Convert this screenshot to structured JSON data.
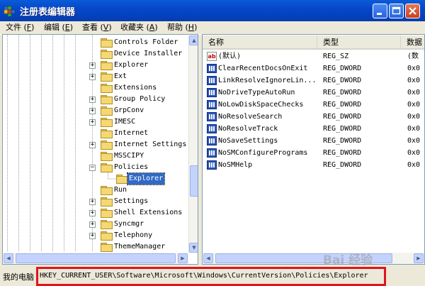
{
  "window": {
    "title": "注册表编辑器",
    "icon": "regedit-icon",
    "controls": [
      "minimize",
      "maximize",
      "close"
    ]
  },
  "menu": [
    {
      "label": "文件",
      "key": "F"
    },
    {
      "label": "编辑",
      "key": "E"
    },
    {
      "label": "查看",
      "key": "V"
    },
    {
      "label": "收藏夹",
      "key": "A"
    },
    {
      "label": "帮助",
      "key": "H"
    }
  ],
  "tree": {
    "items": [
      {
        "label": "Controls Folder",
        "expandable": false
      },
      {
        "label": "Device Installer",
        "expandable": false
      },
      {
        "label": "Explorer",
        "expandable": true,
        "expander": "+"
      },
      {
        "label": "Ext",
        "expandable": true,
        "expander": "+"
      },
      {
        "label": "Extensions",
        "expandable": false
      },
      {
        "label": "Group Policy",
        "expandable": true,
        "expander": "+"
      },
      {
        "label": "GrpConv",
        "expandable": true,
        "expander": "+"
      },
      {
        "label": "IMESC",
        "expandable": true,
        "expander": "+"
      },
      {
        "label": "Internet",
        "expandable": false
      },
      {
        "label": "Internet Settings",
        "expandable": true,
        "expander": "+"
      },
      {
        "label": "MSSCIPY",
        "expandable": false
      },
      {
        "label": "Policies",
        "expandable": true,
        "expander": "−"
      },
      {
        "label": "Explorer",
        "expandable": false,
        "selected": true,
        "child": true
      },
      {
        "label": "Run",
        "expandable": false
      },
      {
        "label": "Settings",
        "expandable": true,
        "expander": "+"
      },
      {
        "label": "Shell Extensions",
        "expandable": true,
        "expander": "+"
      },
      {
        "label": "Syncmgr",
        "expandable": true,
        "expander": "+"
      },
      {
        "label": "Telephony",
        "expandable": true,
        "expander": "+"
      },
      {
        "label": "ThemeManager",
        "expandable": false
      }
    ]
  },
  "list": {
    "columns": [
      "名称",
      "类型",
      "数据"
    ],
    "rows": [
      {
        "name": "(默认)",
        "type": "REG_SZ",
        "data": "(数",
        "icon": "sz"
      },
      {
        "name": "ClearRecentDocsOnExit",
        "type": "REG_DWORD",
        "data": "0x0",
        "icon": "dw"
      },
      {
        "name": "LinkResolveIgnoreLin...",
        "type": "REG_DWORD",
        "data": "0x0",
        "icon": "dw"
      },
      {
        "name": "NoDriveTypeAutoRun",
        "type": "REG_DWORD",
        "data": "0x0",
        "icon": "dw"
      },
      {
        "name": "NoLowDiskSpaceChecks",
        "type": "REG_DWORD",
        "data": "0x0",
        "icon": "dw"
      },
      {
        "name": "NoResolveSearch",
        "type": "REG_DWORD",
        "data": "0x0",
        "icon": "dw"
      },
      {
        "name": "NoResolveTrack",
        "type": "REG_DWORD",
        "data": "0x0",
        "icon": "dw"
      },
      {
        "name": "NoSaveSettings",
        "type": "REG_DWORD",
        "data": "0x0",
        "icon": "dw"
      },
      {
        "name": "NoSMConfigurePrograms",
        "type": "REG_DWORD",
        "data": "0x0",
        "icon": "dw"
      },
      {
        "name": "NoSMHelp",
        "type": "REG_DWORD",
        "data": "0x0",
        "icon": "dw"
      }
    ]
  },
  "status": {
    "prefix": "我的电脑",
    "path": "HKEY_CURRENT_USER\\Software\\Microsoft\\Windows\\CurrentVersion\\Policies\\Explorer"
  },
  "watermark": "Bai 经验",
  "colors": {
    "title_bar": "#0a5cd8",
    "selection": "#316ac5",
    "highlight_box": "#e0141e"
  }
}
